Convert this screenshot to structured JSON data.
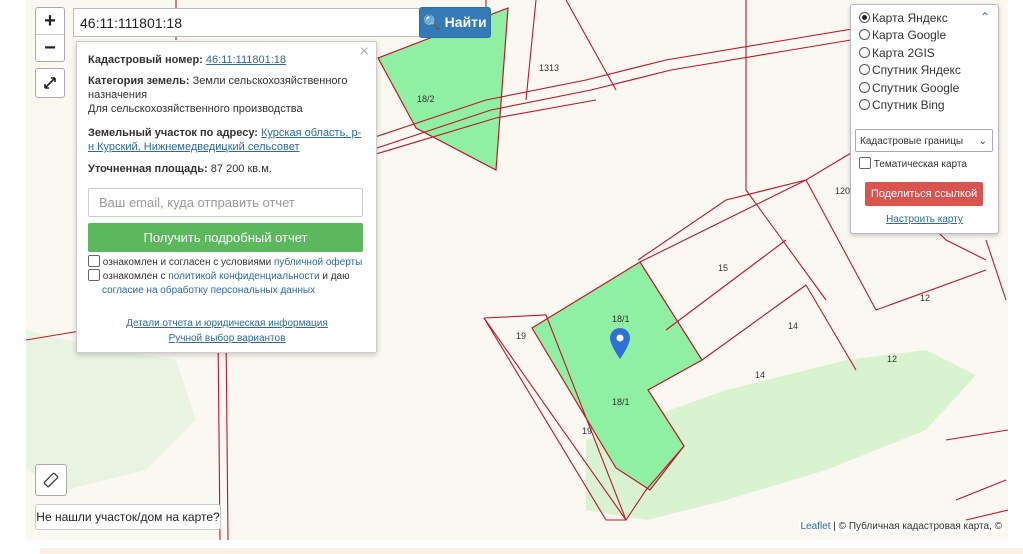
{
  "search": {
    "value": "46:11:111801:18",
    "button": "Найти"
  },
  "zoom": {
    "in": "+",
    "out": "−"
  },
  "popup": {
    "close": "×",
    "cadastral_label": "Кадастровый номер:",
    "cadastral_value": "46:11:111801:18",
    "category_label": "Категория земель:",
    "category_value": "Земли сельскохозяйственного назначения",
    "usage": "Для сельскохозяйственного производства",
    "address_label": "Земельный участок по адресу:",
    "address_value": "Курская область, р-н Курский, Нижнемедведицкий сельсовет",
    "area_label": "Уточненная площадь:",
    "area_value": "87 200 кв.м.",
    "email_placeholder": "Ваш email, куда отправить отчет",
    "report_button": "Получить подробный отчет",
    "agree1_text": "ознакомлен и согласен с условиями",
    "agree1_link": "публичной оферты",
    "agree2_text": "ознакомлен с",
    "agree2_link": "политикой конфиденциальности",
    "agree2_text2": "и даю",
    "agree2_link2": "согласие на обработку персональных данных",
    "details_link": "Детали отчета и юридическая информация",
    "manual_link": "Ручной выбор вариантов"
  },
  "layers": {
    "options": [
      "Карта Яндекс",
      "Карта Google",
      "Карта 2GIS",
      "Спутник Яндекс",
      "Спутник Google",
      "Спутник Bing"
    ],
    "selected": "Карта Яндекс",
    "select_value": "Кадастровые границы",
    "thematic": "Тематическая карта",
    "share": "Поделиться ссылкой",
    "configure": "Настроить карту"
  },
  "parcels": [
    "1313",
    "18/2",
    "120",
    "15",
    "12",
    "18/1",
    "14",
    "19",
    "18/1",
    "12",
    "14",
    "19"
  ],
  "bottom_button": "Не нашли участок/дом на карте?",
  "attribution": {
    "leaflet": "Leaflet",
    "sep": " | © ",
    "pkk": "Публичная кадастровая карта, ©"
  },
  "icons": {
    "zoom_in": "plus-icon",
    "zoom_out": "minus-icon",
    "fullscreen": "expand-icon",
    "ruler": "ruler-icon",
    "search": "search-icon",
    "marker": "map-marker-icon"
  },
  "colors": {
    "parcel_fill": "#8ff0a4",
    "boundary": "#c0162c",
    "green_area": "#d9f2cf",
    "map_bg": "#fbf8f2",
    "search_btn": "#337ab7",
    "report_btn": "#5cb85c",
    "share_btn": "#d9534f"
  }
}
